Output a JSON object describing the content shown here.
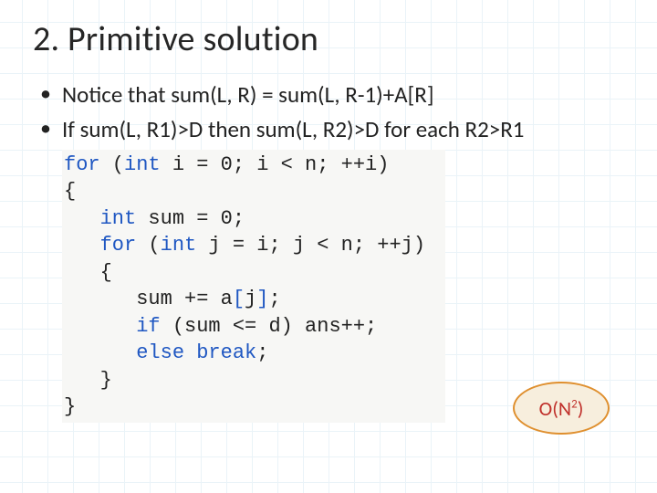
{
  "title": "2. Primitive solution",
  "bullets": [
    "Notice that sum(L, R) = sum(L, R-1)+A[R]",
    "If sum(L, R1)>D then sum(L, R2)>D for each R2>R1"
  ],
  "code": {
    "l1a": "for",
    "l1b": " (",
    "l1c": "int",
    "l1d": " i = 0; i < n; ++i)",
    "l2": "{",
    "l3a": "   ",
    "l3b": "int",
    "l3c": " sum = 0;",
    "l4a": "   ",
    "l4b": "for",
    "l4c": " (",
    "l4d": "int",
    "l4e": " j = i; j < n; ++j)",
    "l5": "   {",
    "l6a": "      sum += a",
    "l6b": "[",
    "l6c": "j",
    "l6d": "]",
    "l6e": ";",
    "l7a": "      ",
    "l7b": "if",
    "l7c": " (sum <= d) ans++;",
    "l8a": "      ",
    "l8b": "else",
    "l8c": " ",
    "l8d": "break",
    "l8e": ";",
    "l9": "   }",
    "l10": "}"
  },
  "badge": {
    "prefix": "O(N",
    "exp": "2",
    "suffix": ")"
  }
}
